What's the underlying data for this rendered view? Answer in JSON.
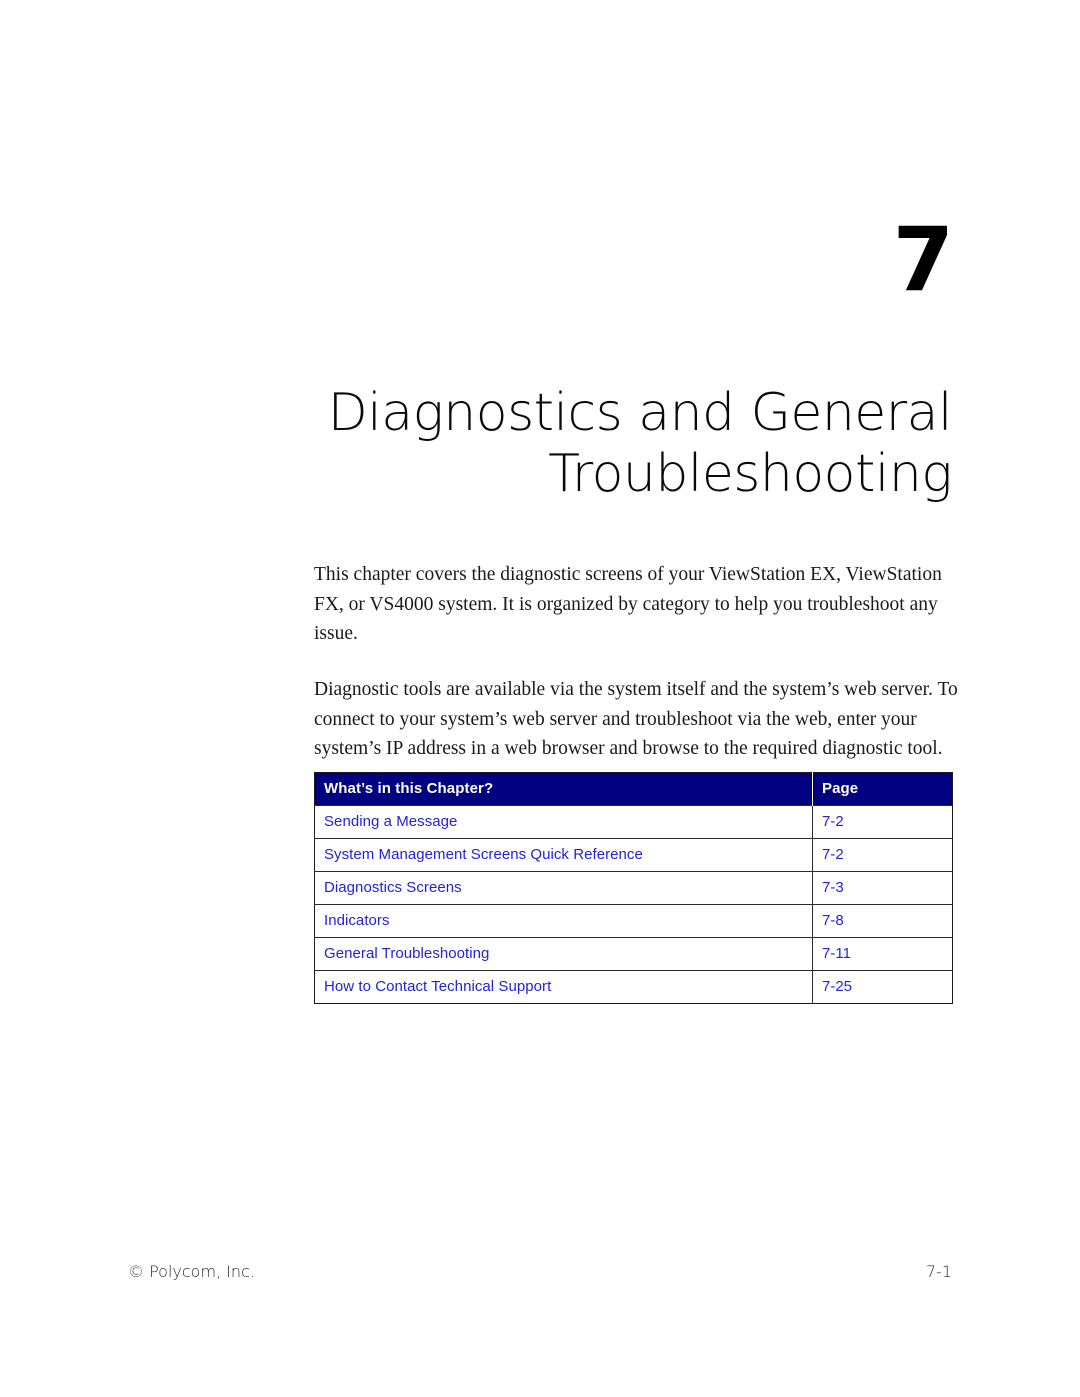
{
  "chapter": {
    "number": "7",
    "title_line1": "Diagnostics and General",
    "title_line2": "Troubleshooting"
  },
  "intro": {
    "paragraph1": "This chapter covers the diagnostic screens of your ViewStation EX, ViewStation FX, or VS4000 system. It is organized by category to help you troubleshoot any issue.",
    "paragraph2": "Diagnostic tools are available via the system itself and the system’s web server. To connect to your system’s web server and troubleshoot via the web, enter your system’s IP address in a web browser and browse to the required diagnostic tool."
  },
  "toc": {
    "header_topic": "What’s in this Chapter?",
    "header_page": "Page",
    "rows": [
      {
        "topic": "Sending a Message",
        "page": "7-2"
      },
      {
        "topic": "System Management Screens Quick Reference",
        "page": "7-2"
      },
      {
        "topic": "Diagnostics Screens",
        "page": "7-3"
      },
      {
        "topic": "Indicators",
        "page": "7-8"
      },
      {
        "topic": "General Troubleshooting",
        "page": "7-11"
      },
      {
        "topic": "How to Contact Technical Support",
        "page": "7-25"
      }
    ]
  },
  "footer": {
    "copyright": "© Polycom, Inc.",
    "page_number": "7-1"
  },
  "colors": {
    "table_header_bg": "#000080",
    "link_text": "#2222dd",
    "body_text": "#1a1a1a"
  }
}
